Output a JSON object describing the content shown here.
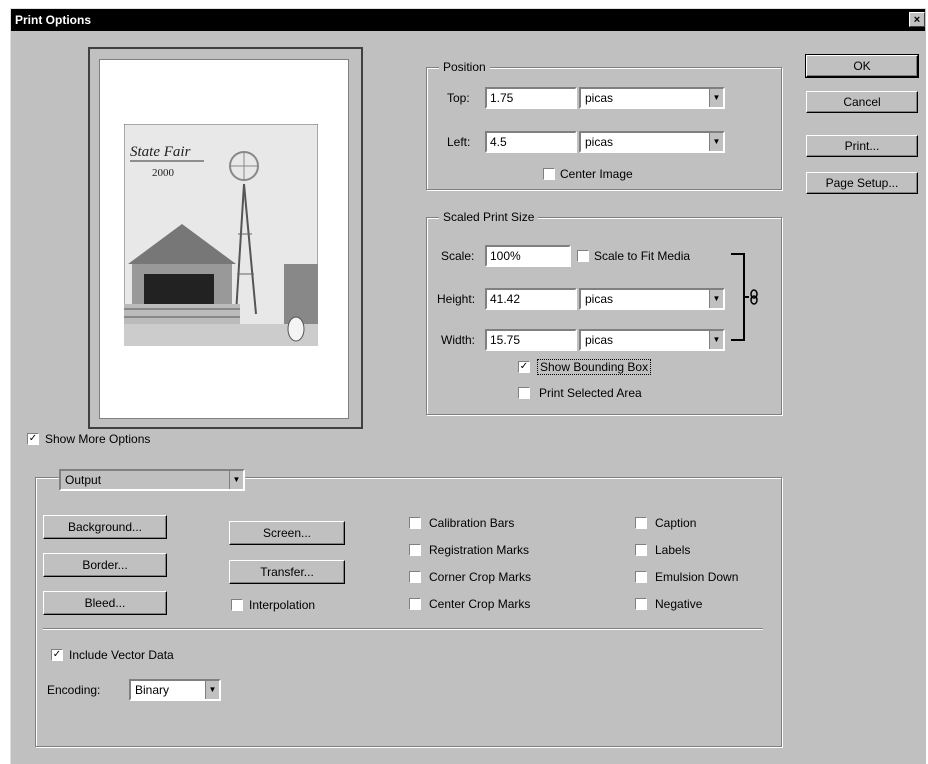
{
  "window": {
    "title": "Print Options",
    "close_glyph": "×"
  },
  "buttons": {
    "ok": "OK",
    "cancel": "Cancel",
    "print": "Print...",
    "page_setup": "Page Setup..."
  },
  "position": {
    "legend": "Position",
    "top_label": "Top:",
    "top_value": "1.75",
    "top_unit": "picas",
    "left_label": "Left:",
    "left_value": "4.5",
    "left_unit": "picas",
    "center_image": "Center Image",
    "center_checked": false
  },
  "scaled": {
    "legend": "Scaled Print Size",
    "scale_label": "Scale:",
    "scale_value": "100%",
    "scale_to_fit": "Scale to Fit Media",
    "scale_to_fit_checked": false,
    "height_label": "Height:",
    "height_value": "41.42",
    "height_unit": "picas",
    "width_label": "Width:",
    "width_value": "15.75",
    "width_unit": "picas",
    "show_bounding_box": "Show Bounding Box",
    "show_bounding_checked": true,
    "print_selected_area": "Print Selected Area",
    "print_selected_checked": false,
    "link_icon": "chain-link-icon"
  },
  "preview": {
    "title_line1": "State Fair",
    "title_line2": "2000"
  },
  "show_more": {
    "label": "Show More Options",
    "checked": true
  },
  "output": {
    "dropdown": "Output",
    "buttons": {
      "background": "Background...",
      "border": "Border...",
      "bleed": "Bleed...",
      "screen": "Screen...",
      "transfer": "Transfer..."
    },
    "interpolation": "Interpolation",
    "checks_col1": [
      "Calibration Bars",
      "Registration Marks",
      "Corner Crop Marks",
      "Center Crop Marks"
    ],
    "checks_col2": [
      "Caption",
      "Labels",
      "Emulsion Down",
      "Negative"
    ],
    "include_vector": "Include Vector Data",
    "include_vector_checked": true,
    "encoding_label": "Encoding:",
    "encoding_value": "Binary"
  }
}
